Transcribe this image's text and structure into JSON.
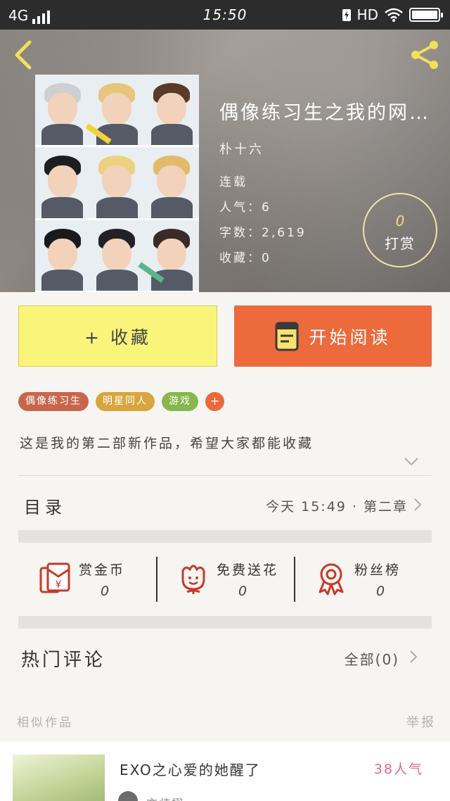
{
  "status_bar": {
    "network": "4G",
    "time": "15:50",
    "hd": "HD"
  },
  "header": {
    "back_icon": "chevron-left-icon",
    "share_icon": "share-icon"
  },
  "book": {
    "title": "偶像练习生之我的网…",
    "author": "朴十六",
    "status": "连载",
    "popularity": "人气：6",
    "word_count": "字数：2,619",
    "favorites": "收藏：0"
  },
  "reward": {
    "count": "0",
    "label": "打赏"
  },
  "actions": {
    "collect_label": "+ 收藏",
    "read_label": "开始阅读"
  },
  "tags": [
    {
      "label": "偶像练习生",
      "color": "#c8664c"
    },
    {
      "label": "明星同人",
      "color": "#d8a53e"
    },
    {
      "label": "游戏",
      "color": "#88b74d"
    }
  ],
  "tag_add_label": "+",
  "description": "这是我的第二部新作品，希望大家都能收藏",
  "toc": {
    "label": "目录",
    "latest": "今天 15:49 · 第二章"
  },
  "stats": [
    {
      "title": "赏金币",
      "value": "0",
      "icon": "red-envelope-icon"
    },
    {
      "title": "免费送花",
      "value": "0",
      "icon": "flower-icon"
    },
    {
      "title": "粉丝榜",
      "value": "0",
      "icon": "medal-icon"
    }
  ],
  "comments": {
    "label": "热门评论",
    "all_label": "全部(0)"
  },
  "similar": {
    "title": "相似作品",
    "report": "举报",
    "items": [
      {
        "name": "EXO之心爱的她醒了",
        "popularity": "38人气",
        "author": "亦歧栩"
      }
    ]
  },
  "colors": {
    "accent_orange": "#ec6a3b",
    "collect_yellow": "#fbf47a",
    "icon_red": "#c8392b"
  }
}
